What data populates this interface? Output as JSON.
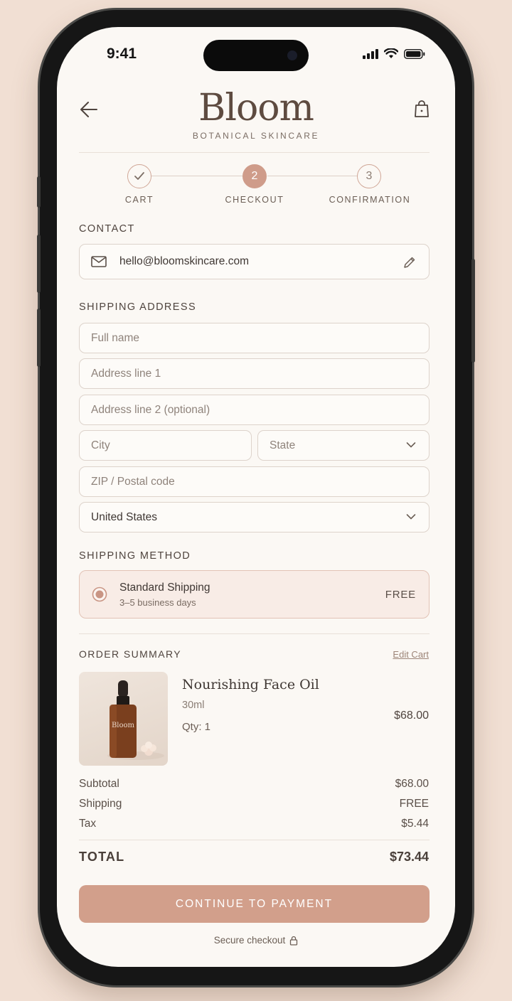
{
  "status_bar": {
    "time": "9:41"
  },
  "header": {
    "brand": "Bloom",
    "tagline": "BOTANICAL SKINCARE",
    "icons": {
      "back": "arrow-left-icon",
      "bag": "shopping-bag-icon"
    }
  },
  "steps": [
    {
      "number": "",
      "label": "CART",
      "state": "done"
    },
    {
      "number": "2",
      "label": "CHECKOUT",
      "state": "active"
    },
    {
      "number": "3",
      "label": "CONFIRMATION",
      "state": "upcoming"
    }
  ],
  "contact": {
    "title": "CONTACT",
    "email": "hello@bloomskincare.com"
  },
  "shipping_address": {
    "title": "SHIPPING ADDRESS",
    "full_name_placeholder": "Full name",
    "address1_placeholder": "Address line 1",
    "address2_placeholder": "Address line 2 (optional)",
    "city_placeholder": "City",
    "state_placeholder": "State",
    "zip_placeholder": "ZIP / Postal code",
    "country": "United States"
  },
  "shipping_method": {
    "title": "SHIPPING METHOD",
    "name": "Standard Shipping",
    "detail": "3–5 business days",
    "price": "FREE",
    "selected": true
  },
  "order_summary": {
    "title": "ORDER SUMMARY",
    "edit_link": "Edit Cart",
    "product": {
      "name": "Nourishing Face Oil",
      "size": "30ml",
      "qty": "Qty: 1",
      "price": "$68.00",
      "bottle_label": "Bloom"
    },
    "rows": [
      {
        "label": "Subtotal",
        "value": "$68.00"
      },
      {
        "label": "Shipping",
        "value": "FREE"
      },
      {
        "label": "Tax",
        "value": "$5.44"
      }
    ],
    "total_label": "TOTAL",
    "total_value": "$73.44"
  },
  "cta": {
    "label": "CONTINUE TO PAYMENT"
  },
  "secure_note": "Secure checkout",
  "colors": {
    "accent": "#d29f8b",
    "background": "#fbf8f4",
    "text": "#3f3733"
  }
}
